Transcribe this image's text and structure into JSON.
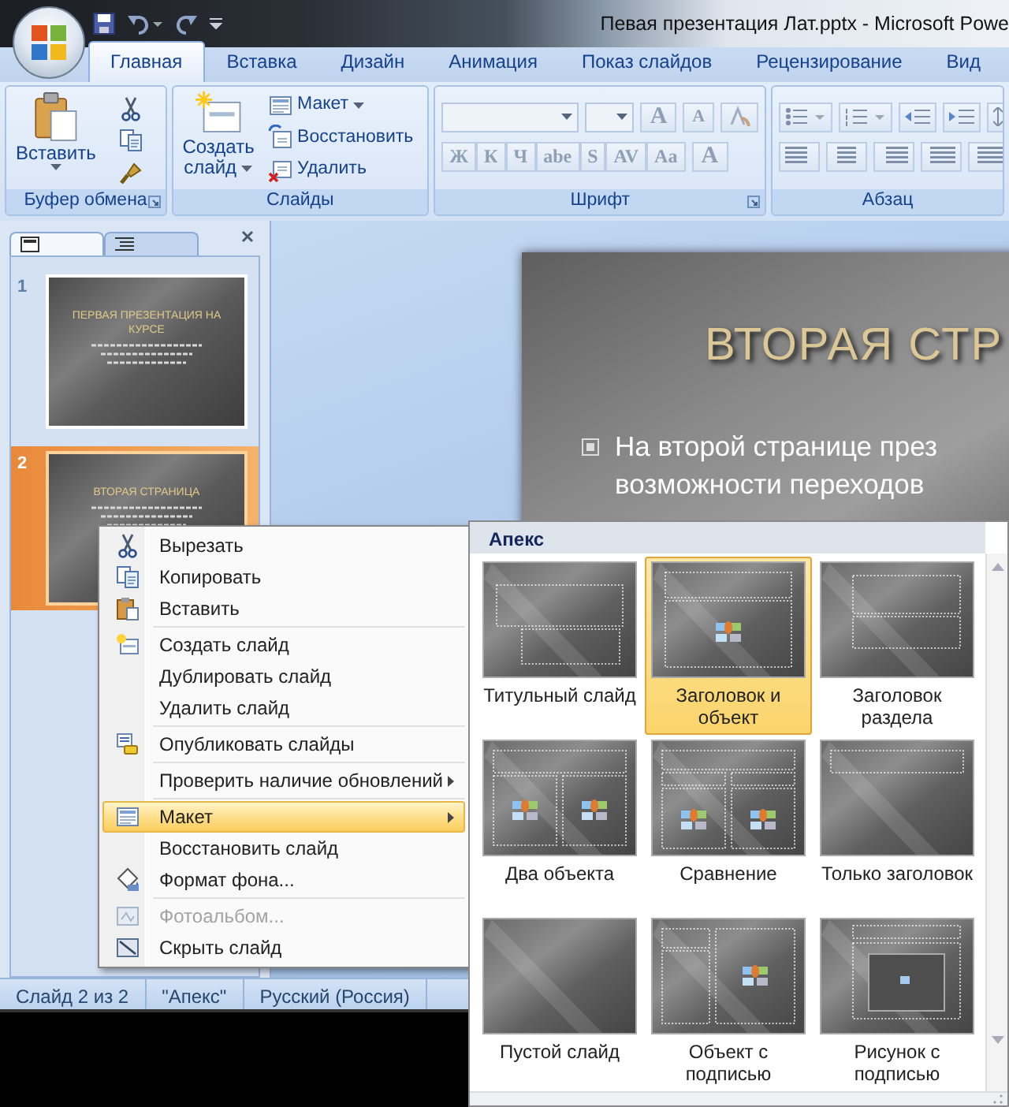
{
  "window": {
    "title": "Певая презентация Лат.pptx - Microsoft Powe"
  },
  "ribbon_tabs": [
    {
      "label": "Главная",
      "selected": true
    },
    {
      "label": "Вставка",
      "selected": false
    },
    {
      "label": "Дизайн",
      "selected": false
    },
    {
      "label": "Анимация",
      "selected": false
    },
    {
      "label": "Показ слайдов",
      "selected": false
    },
    {
      "label": "Рецензирование",
      "selected": false
    },
    {
      "label": "Вид",
      "selected": false
    }
  ],
  "ribbon": {
    "clipboard": {
      "label": "Буфер обмена",
      "paste": "Вставить"
    },
    "slides": {
      "label": "Слайды",
      "new_slide": "Создать слайд",
      "layout": "Макет",
      "reset": "Восстановить",
      "delete": "Удалить"
    },
    "font": {
      "label": "Шрифт",
      "grow": "A",
      "shrink": "A",
      "styles": [
        "Ж",
        "К",
        "Ч",
        "abe",
        "S",
        "AV",
        "Aa"
      ],
      "color_button": "A"
    },
    "paragraph": {
      "label": "Абзац"
    }
  },
  "pane_tabs": [
    {
      "kind": "slides",
      "selected": true
    },
    {
      "kind": "outline",
      "selected": false
    }
  ],
  "thumbnails": [
    {
      "number": "1",
      "title": "ПЕРВАЯ ПРЕЗЕНТАЦИЯ НА КУРСЕ",
      "selected": false
    },
    {
      "number": "2",
      "title": "ВТОРАЯ СТРАНИЦА",
      "selected": true
    }
  ],
  "slide": {
    "title": "ВТОРАЯ СТР",
    "bullet_lines": [
      "На второй странице през",
      "возможности переходов"
    ]
  },
  "context_menu": [
    [
      {
        "label": "Вырезать",
        "kind": "cut",
        "submenu": false,
        "disabled": false,
        "selected": false
      },
      {
        "label": "Копировать",
        "kind": "copy",
        "submenu": false,
        "disabled": false,
        "selected": false
      },
      {
        "label": "Вставить",
        "kind": "paste",
        "submenu": false,
        "disabled": false,
        "selected": false
      }
    ],
    [
      {
        "label": "Создать слайд",
        "kind": "new-slide",
        "submenu": false,
        "disabled": false,
        "selected": false
      },
      {
        "label": "Дублировать слайд",
        "kind": "plain",
        "submenu": false,
        "disabled": false,
        "selected": false
      },
      {
        "label": "Удалить слайд",
        "kind": "plain",
        "submenu": false,
        "disabled": false,
        "selected": false
      }
    ],
    [
      {
        "label": "Опубликовать слайды",
        "kind": "publish",
        "submenu": false,
        "disabled": false,
        "selected": false
      }
    ],
    [
      {
        "label": "Проверить наличие обновлений",
        "kind": "plain",
        "submenu": true,
        "disabled": false,
        "selected": false
      }
    ],
    [
      {
        "label": "Макет",
        "kind": "layout",
        "submenu": true,
        "disabled": false,
        "selected": true
      },
      {
        "label": "Восстановить слайд",
        "kind": "plain",
        "submenu": false,
        "disabled": false,
        "selected": false
      },
      {
        "label": "Формат фона...",
        "kind": "background",
        "submenu": false,
        "disabled": false,
        "selected": false
      }
    ],
    [
      {
        "label": "Фотоальбом...",
        "kind": "photo-album",
        "submenu": false,
        "disabled": true,
        "selected": false
      },
      {
        "label": "Скрыть слайд",
        "kind": "hide",
        "submenu": false,
        "disabled": false,
        "selected": false
      }
    ]
  ],
  "layout_gallery": {
    "theme": "Апекс",
    "layouts": [
      {
        "label": "Титульный слайд",
        "kind": "title",
        "selected": false
      },
      {
        "label": "Заголовок и объект",
        "kind": "title-content",
        "selected": true
      },
      {
        "label": "Заголовок раздела",
        "kind": "section",
        "selected": false
      },
      {
        "label": "Два объекта",
        "kind": "two-content",
        "selected": false
      },
      {
        "label": "Сравнение",
        "kind": "comparison",
        "selected": false
      },
      {
        "label": "Только заголовок",
        "kind": "title-only",
        "selected": false
      },
      {
        "label": "Пустой слайд",
        "kind": "blank",
        "selected": false
      },
      {
        "label": "Объект с подписью",
        "kind": "content-caption",
        "selected": false
      },
      {
        "label": "Рисунок с подписью",
        "kind": "picture-caption",
        "selected": false
      }
    ]
  },
  "status_bar": [
    "Слайд 2 из 2",
    "\"Апекс\"",
    "Русский (Россия)"
  ]
}
